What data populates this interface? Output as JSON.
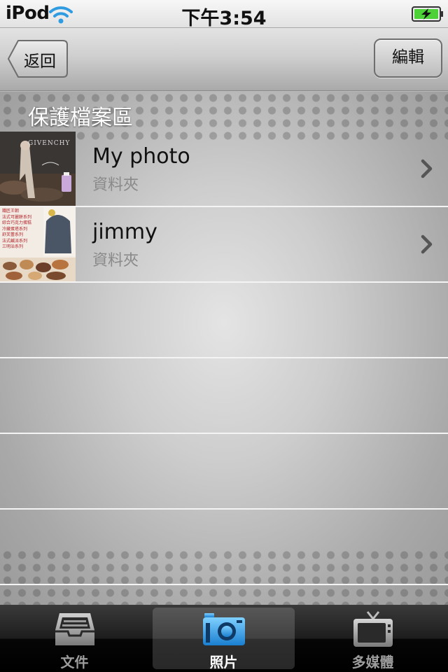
{
  "status_bar": {
    "carrier": "iPod",
    "time": "下午3:54",
    "wifi_icon": "wifi-icon",
    "battery_icon": "battery-charging-icon"
  },
  "nav": {
    "back_label": "返回",
    "edit_label": "編輯"
  },
  "section": {
    "title": "保護檔案區"
  },
  "folders": [
    {
      "title": "My photo",
      "subtitle": "資料夾",
      "thumbnail_text": "GIVENCHY",
      "chevron_icon": "chevron-right-icon"
    },
    {
      "title": "jimmy",
      "subtitle": "資料夾",
      "thumbnail_lines": [
        "鐵匠王朝",
        "法式可麗餅系列",
        "綜合巧克力蛋糕",
        "冷藏蛋塔系列",
        "舒芙蕾系列",
        "法式鹹派系列",
        "三明治系列"
      ],
      "chevron_icon": "chevron-right-icon"
    }
  ],
  "tabs": [
    {
      "label": "文件",
      "icon": "inbox-tray-icon",
      "selected": false
    },
    {
      "label": "照片",
      "icon": "camera-icon",
      "selected": true
    },
    {
      "label": "多媒體",
      "icon": "tv-icon",
      "selected": false
    }
  ],
  "colors": {
    "accent_blue": "#2f9be0",
    "tab_bar": "#1a1a1a",
    "row_separator": "#f4f4f4"
  }
}
